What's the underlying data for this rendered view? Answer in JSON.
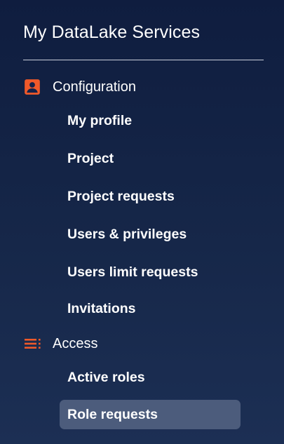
{
  "app": {
    "title": "My DataLake Services"
  },
  "colors": {
    "accent": "#f0592a",
    "active_bg": "#4c5c7c",
    "background_top": "#0f1d3f",
    "background_bottom": "#1c2f54"
  },
  "sections": [
    {
      "label": "Configuration",
      "icon": "account-box-icon",
      "items": [
        {
          "label": "My profile",
          "active": false
        },
        {
          "label": "Project",
          "active": false
        },
        {
          "label": "Project requests",
          "active": false
        },
        {
          "label": "Users & privileges",
          "active": false
        },
        {
          "label": "Users limit requests",
          "active": false
        },
        {
          "label": "Invitations",
          "active": false
        }
      ]
    },
    {
      "label": "Access",
      "icon": "list-lines-icon",
      "items": [
        {
          "label": "Active roles",
          "active": false
        },
        {
          "label": "Role requests",
          "active": true
        }
      ]
    }
  ]
}
